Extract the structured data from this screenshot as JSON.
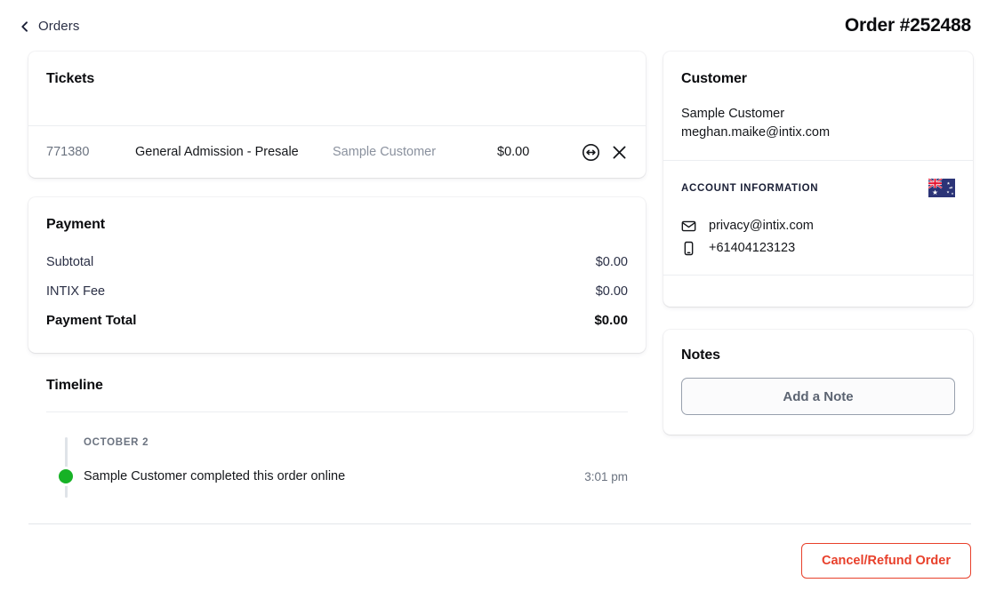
{
  "header": {
    "back_label": "Orders",
    "back_icon": "chevron-left-icon",
    "order_title": "Order #252488"
  },
  "tickets": {
    "title": "Tickets",
    "rows": [
      {
        "id": "771380",
        "name": "General Admission - Presale",
        "customer": "Sample Customer",
        "price": "$0.00",
        "actions": [
          "exchange-icon",
          "remove-icon"
        ]
      }
    ]
  },
  "payment": {
    "title": "Payment",
    "rows": [
      {
        "label": "Subtotal",
        "value": "$0.00"
      },
      {
        "label": "INTIX Fee",
        "value": "$0.00"
      }
    ],
    "total": {
      "label": "Payment Total",
      "value": "$0.00"
    }
  },
  "timeline": {
    "title": "Timeline",
    "date": "OCTOBER 2",
    "events": [
      {
        "text": "Sample Customer completed this order online",
        "time": "3:01 pm",
        "dot_color": "#17b226"
      }
    ]
  },
  "customer": {
    "title": "Customer",
    "name": "Sample Customer",
    "email": "meghan.maike@intix.com",
    "account_section_label": "ACCOUNT INFORMATION",
    "flag_icon": "australia-flag-icon",
    "contacts": [
      {
        "icon": "envelope-icon",
        "value": "privacy@intix.com"
      },
      {
        "icon": "mobile-phone-icon",
        "value": "+61404123123"
      }
    ]
  },
  "notes": {
    "title": "Notes",
    "add_note_label": "Add a Note"
  },
  "footer": {
    "cancel_refund_label": "Cancel/Refund Order"
  },
  "colors": {
    "danger": "#e8402b",
    "success": "#17b226",
    "muted": "#6b7380",
    "background": "#ffffff"
  }
}
